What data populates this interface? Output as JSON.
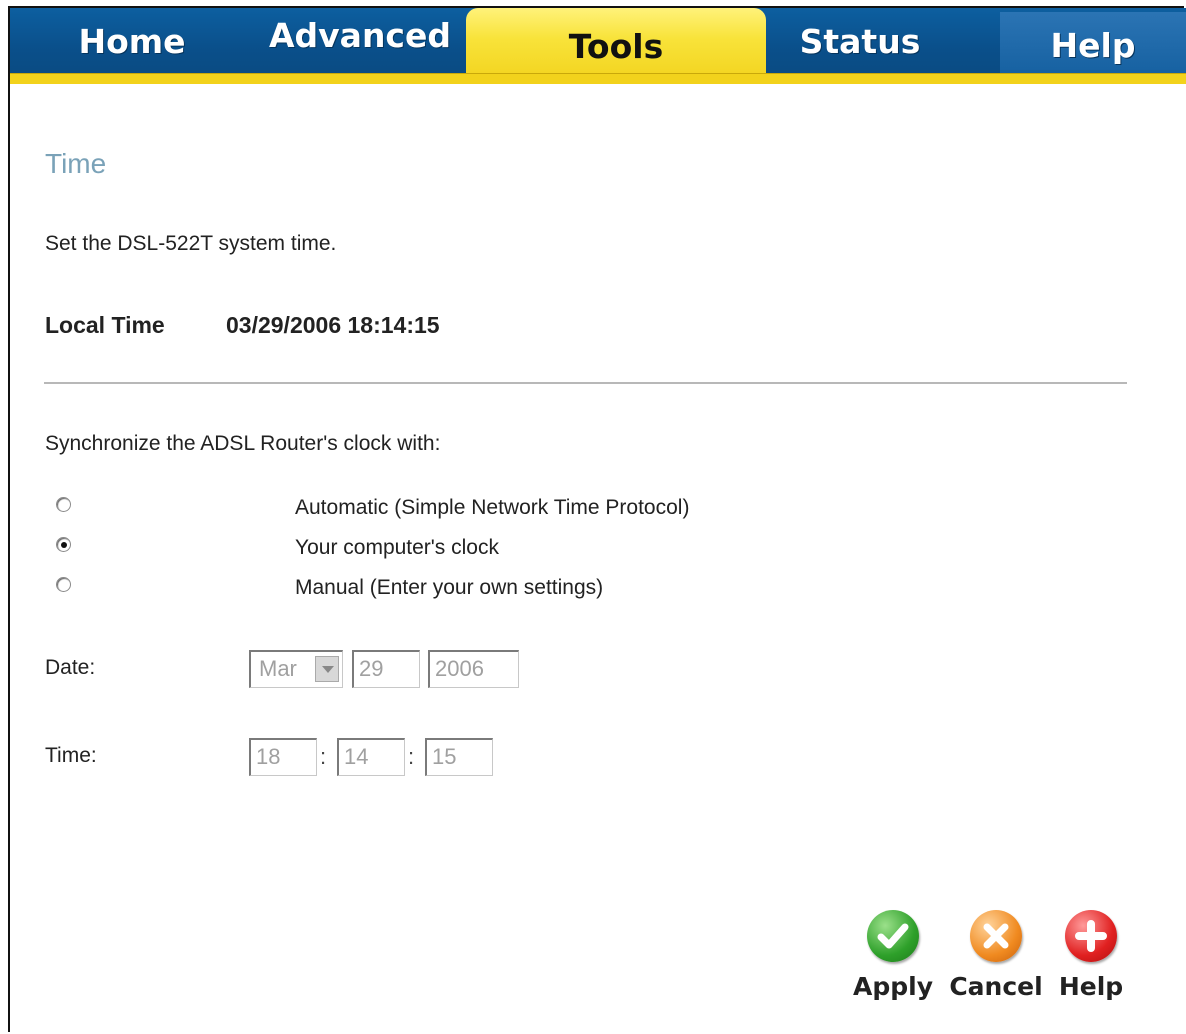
{
  "nav": {
    "tabs": [
      {
        "label": "Home"
      },
      {
        "label": "Advanced"
      },
      {
        "label": "Tools"
      },
      {
        "label": "Status"
      },
      {
        "label": "Help"
      }
    ],
    "active_tab": "Tools"
  },
  "page": {
    "title": "Time",
    "description": "Set the DSL-522T system time."
  },
  "local_time": {
    "label": "Local Time",
    "value": "03/29/2006 18:14:15"
  },
  "sync": {
    "prompt": "Synchronize the ADSL Router's clock with:",
    "options": [
      {
        "label": "Automatic (Simple Network Time Protocol)",
        "checked": false
      },
      {
        "label": "Your computer's clock",
        "checked": true
      },
      {
        "label": "Manual (Enter your own settings)",
        "checked": false
      }
    ]
  },
  "date": {
    "label": "Date:",
    "month": "Mar",
    "day": "29",
    "year": "2006"
  },
  "time": {
    "label": "Time:",
    "hour": "18",
    "minute": "14",
    "second": "15",
    "separator": ":"
  },
  "actions": {
    "apply": "Apply",
    "cancel": "Cancel",
    "help": "Help"
  },
  "colors": {
    "tabbar": "#0a4f8a",
    "active_tab": "#f8e33a",
    "title": "#7aa2b8"
  }
}
